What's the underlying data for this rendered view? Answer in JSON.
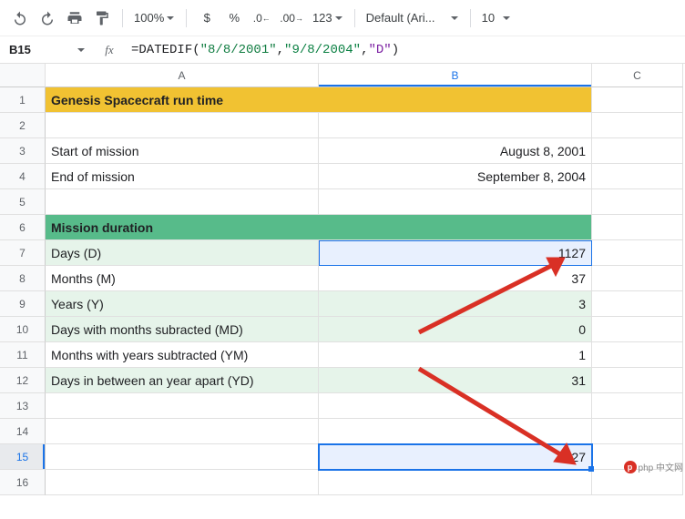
{
  "toolbar": {
    "zoom": "100%",
    "currency": "$",
    "percent": "%",
    "dec_dec": ".0",
    "inc_dec": ".00",
    "more_formats": "123",
    "font": "Default (Ari...",
    "font_size": "10"
  },
  "namebox": "B15",
  "fx_label": "fx",
  "formula": {
    "eq": "=",
    "fn": "DATEDIF",
    "arg1": "\"8/8/2001\"",
    "arg2": "\"9/8/2004\"",
    "arg3": "\"D\""
  },
  "cols": [
    "A",
    "B",
    "C"
  ],
  "rownums": [
    "1",
    "2",
    "3",
    "4",
    "5",
    "6",
    "7",
    "8",
    "9",
    "10",
    "11",
    "12",
    "13",
    "14",
    "15",
    "16"
  ],
  "cells": {
    "A1": "Genesis Spacecraft run time",
    "A3": "Start of mission",
    "B3": "August 8, 2001",
    "A4": "End of mission",
    "B4": "September 8, 2004",
    "A6": "Mission duration",
    "A7": "Days (D)",
    "B7": "1127",
    "A8": "Months (M)",
    "B8": "37",
    "A9": "Years (Y)",
    "B9": "3",
    "A10": "Days with months subracted (MD)",
    "B10": "0",
    "A11": "Months with years subtracted (YM)",
    "B11": "1",
    "A12": "Days in between an year apart (YD)",
    "B12": "31",
    "B15": "1127"
  },
  "watermark": "php 中文网"
}
